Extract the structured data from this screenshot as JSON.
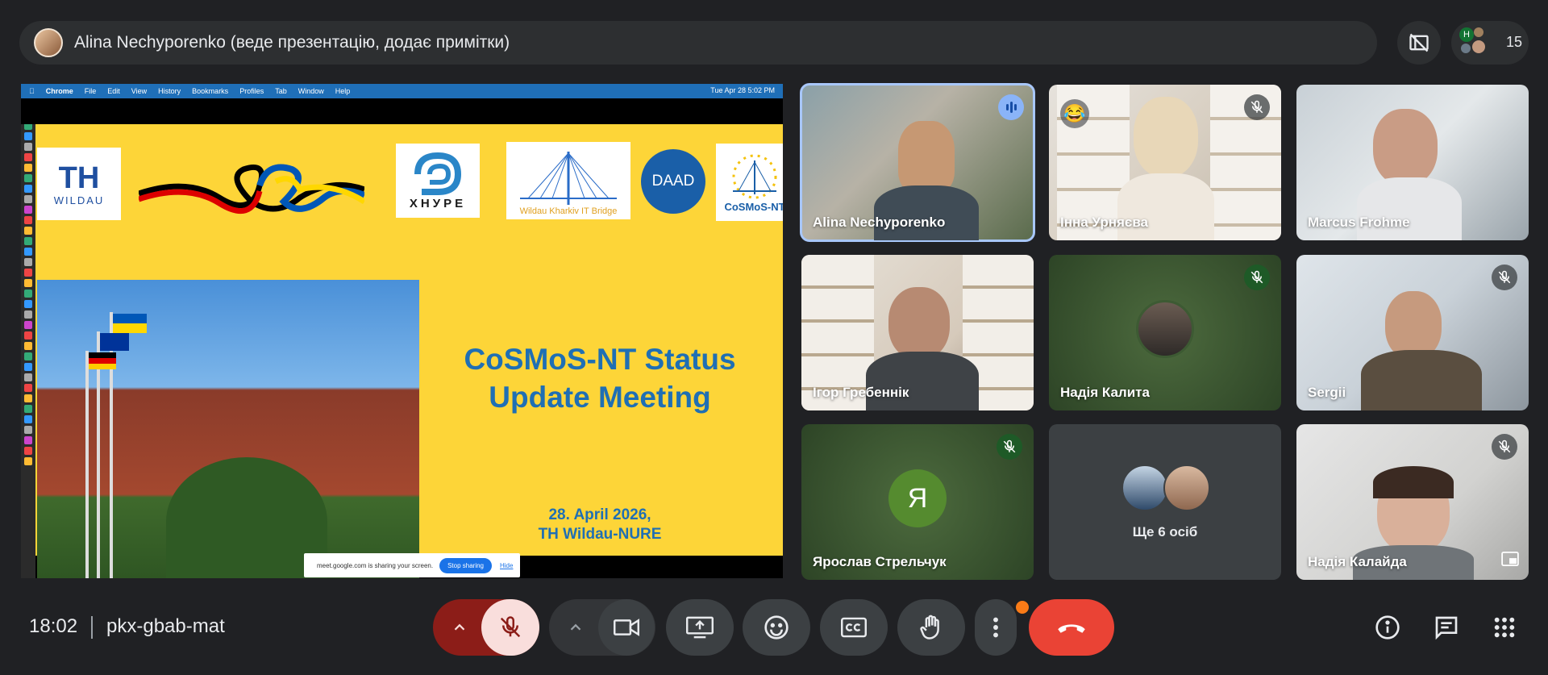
{
  "topbar": {
    "presenter_label": "Alina Nechyporenko (веде презентацію, додає примітки)",
    "participant_count": "15"
  },
  "share": {
    "menubar": [
      "Chrome",
      "File",
      "Edit",
      "View",
      "History",
      "Bookmarks",
      "Profiles",
      "Tab",
      "Window",
      "Help"
    ],
    "menubar_clock": "Tue Apr 28  5:02 PM",
    "slide": {
      "logo_th": "TH",
      "logo_th_sub": "WILDAU",
      "logo_nure": "ХНУРЕ",
      "logo_bridge": "Wildau Kharkiv IT Bridge",
      "logo_daad": "DAAD",
      "logo_cosmos": "CoSMoS-NT",
      "title_line1": "CoSMoS-NT Status",
      "title_line2": "Update Meeting",
      "date_line1": "28. April 2026,",
      "date_line2": "TH Wildau-NURE"
    },
    "share_notice": {
      "text": "meet.google.com is sharing your screen.",
      "stop_label": "Stop sharing",
      "hide_label": "Hide"
    }
  },
  "tiles": [
    {
      "name": "Alina Nechyporenko",
      "state": "speaking"
    },
    {
      "name": "Інна Урняєва",
      "state": "muted",
      "reaction": "😂"
    },
    {
      "name": "Marcus Frohme",
      "state": "video"
    },
    {
      "name": "Ігор Гребеннік",
      "state": "video"
    },
    {
      "name": "Надія Калита",
      "state": "muted"
    },
    {
      "name": "Sergii",
      "state": "muted"
    },
    {
      "name": "Ярослав Стрельчук",
      "state": "muted",
      "initial": "Я"
    },
    {
      "name": "Ще 6 осіб",
      "state": "others"
    },
    {
      "name": "Надія Калайда",
      "state": "muted"
    }
  ],
  "bottombar": {
    "time": "18:02",
    "meeting_code": "pkx-gbab-mat"
  },
  "colors": {
    "background": "#202124",
    "end_call": "#ea4335",
    "muted_mic_bg": "#f9dedc",
    "mic_group_bg": "#8c1d18",
    "slide_yellow": "#fdd538",
    "slide_text": "#1f6fb4"
  }
}
